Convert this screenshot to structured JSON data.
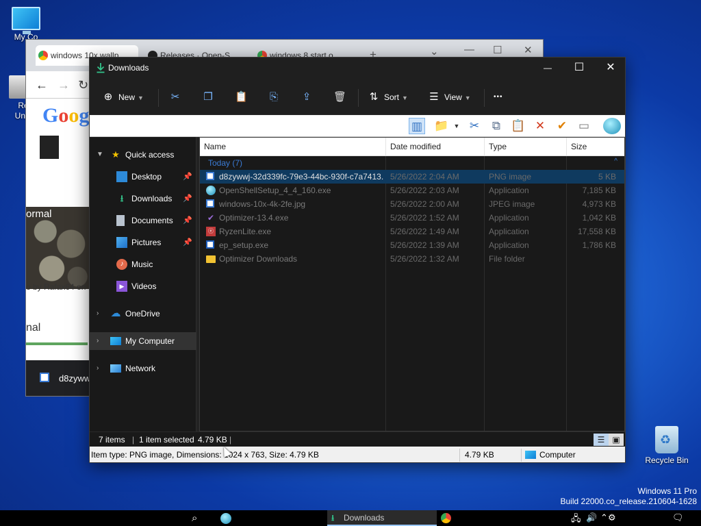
{
  "desktop": {
    "icons": [
      {
        "label": "My Co",
        "icon": "computer-icon"
      },
      {
        "label": "Re Unin",
        "icon": "uninstaller-icon"
      },
      {
        "label": "Recycle Bin",
        "icon": "recycle-bin-icon"
      }
    ],
    "watermark": {
      "line1": "Windows 11 Pro",
      "line2": "Build 22000.co_release.210604-1628"
    }
  },
  "browser": {
    "tabs": [
      {
        "label": "windows 10x wallp",
        "icon": "google-icon"
      },
      {
        "label": "Releases · Open-S",
        "icon": "github-icon"
      },
      {
        "label": "windows 8 start o",
        "icon": "google-icon"
      }
    ],
    "new_tab": "+",
    "google": [
      "G",
      "o",
      "o",
      "g"
    ],
    "page_snippets": {
      "normal": "ormal",
      "by": "o by Rafax64 on",
      "nal": "nal",
      "download": "d8zywwj"
    }
  },
  "explorer": {
    "title": "Downloads",
    "controls": {
      "minimize": "—",
      "maximize": "☐",
      "close": "✕"
    },
    "commands": {
      "new": "New",
      "sort": "Sort",
      "view": "View",
      "more": "•••"
    },
    "nav": {
      "quick_access": "Quick access",
      "desktop": "Desktop",
      "downloads": "Downloads",
      "documents": "Documents",
      "pictures": "Pictures",
      "music": "Music",
      "videos": "Videos",
      "onedrive": "OneDrive",
      "my_computer": "My Computer",
      "network": "Network"
    },
    "columns": {
      "name": "Name",
      "date": "Date modified",
      "type": "Type",
      "size": "Size"
    },
    "group": {
      "label": "Today (7)",
      "collapse": "^"
    },
    "files": [
      {
        "name": "d8zywwj-32d339fc-79e3-44bc-930f-c7a7413...",
        "date": "5/26/2022 2:04 AM",
        "type": "PNG image",
        "size": "5 KB",
        "icon": "png-file-icon"
      },
      {
        "name": "OpenShellSetup_4_4_160.exe",
        "date": "5/26/2022 2:03 AM",
        "type": "Application",
        "size": "7,185 KB",
        "icon": "shell-setup-icon"
      },
      {
        "name": "windows-10x-4k-2fe.jpg",
        "date": "5/26/2022 2:00 AM",
        "type": "JPEG image",
        "size": "4,973 KB",
        "icon": "jpg-file-icon"
      },
      {
        "name": "Optimizer-13.4.exe",
        "date": "5/26/2022 1:52 AM",
        "type": "Application",
        "size": "1,042 KB",
        "icon": "optimizer-icon"
      },
      {
        "name": "RyzenLite.exe",
        "date": "5/26/2022 1:49 AM",
        "type": "Application",
        "size": "17,558 KB",
        "icon": "exe-file-icon"
      },
      {
        "name": "ep_setup.exe",
        "date": "5/26/2022 1:39 AM",
        "type": "Application",
        "size": "1,786 KB",
        "icon": "setup-file-icon"
      },
      {
        "name": "Optimizer Downloads",
        "date": "5/26/2022 1:32 AM",
        "type": "File folder",
        "size": "",
        "icon": "folder-icon"
      }
    ],
    "status": {
      "items": "7 items",
      "selected": "1 item selected",
      "selected_size": "4.79 KB"
    },
    "infobar": {
      "details": "Item type: PNG image, Dimensions: 1024 x 763, Size: 4.79 KB",
      "size": "4.79 KB",
      "location": "Computer"
    }
  },
  "taskbar": {
    "downloads_label": "Downloads"
  }
}
